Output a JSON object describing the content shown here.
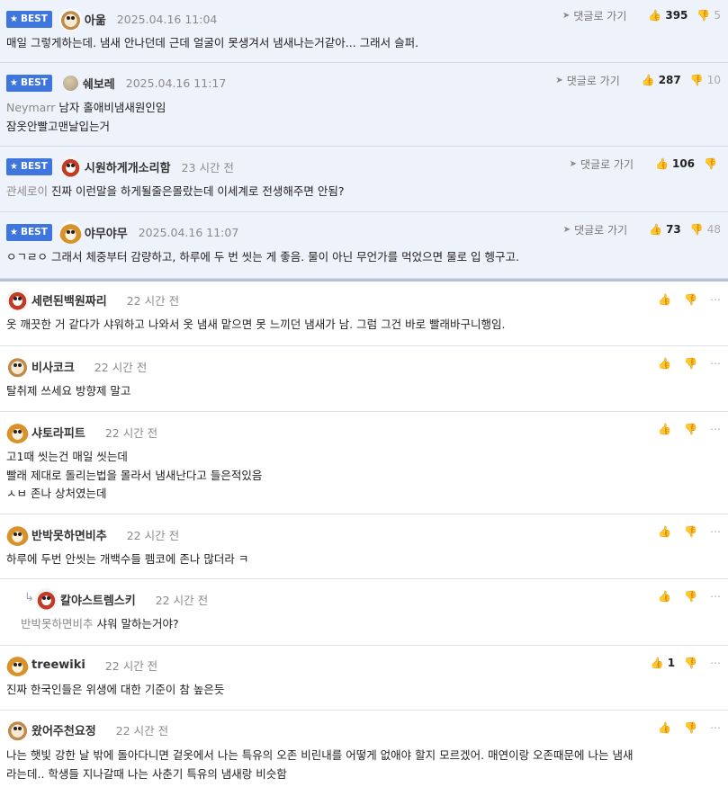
{
  "comments": [
    {
      "best": true,
      "badge": "BEST",
      "avatar": "dog-icon",
      "nick": "아욺",
      "date": "2025.04.16 11:04",
      "reply_label": "댓글로 가기",
      "up": "395",
      "down": "5",
      "mention": "",
      "lines": [
        "매일 그렇게하는데. 냄새 안나던데 근데 얼굴이 못생겨서 냄새나는거같아... 그래서 슬퍼."
      ]
    },
    {
      "best": true,
      "badge": "BEST",
      "avatar": "stone-icon",
      "nick": "쉐보레",
      "date": "2025.04.16 11:17",
      "reply_label": "댓글로 가기",
      "up": "287",
      "down": "10",
      "mention": "Neymarr",
      "lines": [
        "남자 홀애비냄새원인임",
        "잠옷안빨고맨날입는거"
      ]
    },
    {
      "best": true,
      "badge": "BEST",
      "avatar": "red-dog-icon",
      "nick": "시원하게개소리함",
      "date": "23 시간 전",
      "reply_label": "댓글로 가기",
      "up": "106",
      "down": "",
      "mention": "관세로이",
      "lines": [
        "진짜 이런말을 하게될줄은몰랐는데 이세계로 전생해주면 안됨?"
      ]
    },
    {
      "best": true,
      "badge": "BEST",
      "avatar": "fox-icon",
      "nick": "야무야무",
      "date": "2025.04.16 11:07",
      "reply_label": "댓글로 가기",
      "up": "73",
      "down": "48",
      "mention": "",
      "lines": [
        "ㅇㄱㄹㅇ 그래서 체중부터 감량하고, 하루에 두 번 씻는 게 좋음. 물이 아닌 무언가를 먹었으면 물로 입 헹구고."
      ]
    },
    {
      "best": false,
      "avatar": "red-dog-icon",
      "nick": "세련된백원짜리",
      "date": "22 시간 전",
      "up": "",
      "down": "",
      "mention": "",
      "lines": [
        "옷 깨끗한 거 같다가 샤워하고 나와서 옷 냄새 맡으면 못 느끼던 냄새가 남. 그럼 그건 바로 빨래바구니행임."
      ]
    },
    {
      "best": false,
      "avatar": "dog-icon",
      "nick": "비사코크",
      "date": "22 시간 전",
      "up": "",
      "down": "",
      "mention": "",
      "lines": [
        "탈취제 쓰세요 방향제 말고"
      ]
    },
    {
      "best": false,
      "avatar": "fox-icon",
      "nick": "샤토라피트",
      "date": "22 시간 전",
      "up": "",
      "down": "",
      "mention": "",
      "lines": [
        "고1때 씻는건 매일 씻는데",
        "빨래 제대로 돌리는법을 몰라서 냄새난다고 들은적있음",
        "ㅅㅂ 존나 상처였는데"
      ]
    },
    {
      "best": false,
      "avatar": "fox-icon",
      "nick": "반박못하면비추",
      "date": "22 시간 전",
      "up": "",
      "down": "",
      "mention": "",
      "lines": [
        "하루에 두번 안씻는 개백수들 펨코에 존나 많더라 ㅋ"
      ]
    },
    {
      "best": false,
      "reply": true,
      "avatar": "red-dog-icon",
      "nick": "칼야스트렘스키",
      "date": "22 시간 전",
      "up": "",
      "down": "",
      "mention": "반박못하면비추",
      "lines": [
        "샤워 말하는거야?"
      ]
    },
    {
      "best": false,
      "avatar": "fox-icon",
      "nick": "treewiki",
      "date": "22 시간 전",
      "up": "1",
      "down": "",
      "mention": "",
      "lines": [
        "진짜 한국인들은 위생에 대한 기준이 참 높은듯"
      ]
    },
    {
      "best": false,
      "avatar": "dog-icon",
      "nick": "왔어주천요정",
      "date": "22 시간 전",
      "up": "",
      "down": "",
      "mention": "",
      "lines": [
        "나는 햇빛 강한 날 밖에 돌아다니면 겉옷에서 나는 특유의 오존 비린내를 어떻게 없애야 할지 모르겠어. 매연이랑 오존때문에 나는 냄새",
        "라는데.. 학생들 지나갈때 나는 사춘기 특유의 냄새랑 비슷함"
      ]
    }
  ]
}
